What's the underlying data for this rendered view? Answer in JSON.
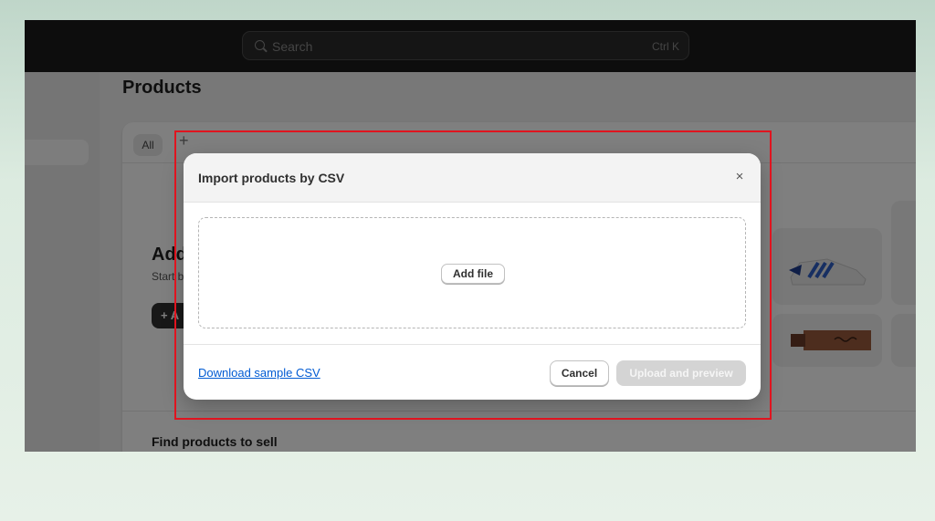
{
  "topbar": {
    "search_placeholder": "Search",
    "search_shortcut": "Ctrl K"
  },
  "page": {
    "title": "Products",
    "tabs": [
      "All",
      "+"
    ],
    "empty_state": {
      "title": "Add",
      "subtitle": "Start b",
      "button_label": "+ A"
    },
    "find_title": "Find products to sell"
  },
  "modal": {
    "title": "Import products by CSV",
    "close_glyph": "×",
    "add_file_label": "Add file",
    "download_link": "Download sample CSV",
    "cancel_label": "Cancel",
    "upload_label": "Upload and preview",
    "upload_disabled": true
  },
  "annotation": {
    "highlight_color": "#e0141f"
  }
}
